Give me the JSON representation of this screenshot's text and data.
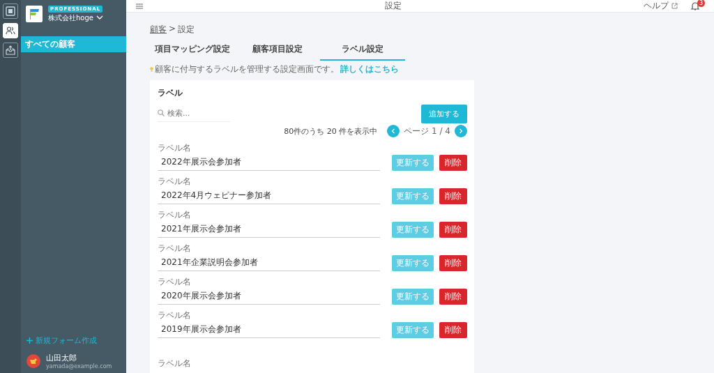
{
  "sidebar": {
    "plan_badge": "PROFESSIONAL",
    "company": "株式会社hoge",
    "rail_icons": [
      {
        "selected": false
      },
      {
        "selected": true
      },
      {
        "selected": false
      }
    ],
    "items": [
      {
        "label": "すべての顧客",
        "selected": true
      }
    ],
    "new_form_link": "新規フォーム作成",
    "user": {
      "name": "山田太郎",
      "email": "yamada@example.com"
    }
  },
  "header": {
    "title": "設定",
    "help": "ヘルプ",
    "notification_count": "3"
  },
  "breadcrumb": {
    "link": "顧客",
    "separator": ">",
    "current": "設定"
  },
  "tabs": [
    {
      "label": "項目マッピング設定",
      "selected": false
    },
    {
      "label": "顧客項目設定",
      "selected": false
    },
    {
      "label": "ラベル設定",
      "selected": true
    }
  ],
  "hint": {
    "text": "顧客に付与するラベルを管理する設定画面です。",
    "link": "詳しくはこちら"
  },
  "card": {
    "title": "ラベル",
    "search": {
      "placeholder": "検索..."
    },
    "add_button": "追加する",
    "count": "80件のうち 20 件を表示中",
    "page": "ページ 1 / 4",
    "rows": [
      {
        "label": "ラベル名",
        "value": "2022年展示会参加者",
        "update": "更新する",
        "delete": "削除"
      },
      {
        "label": "ラベル名",
        "value": "2022年4月ウェビナー参加者",
        "update": "更新する",
        "delete": "削除"
      },
      {
        "label": "ラベル名",
        "value": "2021年展示会参加者",
        "update": "更新する",
        "delete": "削除"
      },
      {
        "label": "ラベル名",
        "value": "2021年企業説明会参加者",
        "update": "更新する",
        "delete": "削除"
      },
      {
        "label": "ラベル名",
        "value": "2020年展示会参加者",
        "update": "更新する",
        "delete": "削除"
      },
      {
        "label": "ラベル名",
        "value": "2019年展示会参加者",
        "update": "更新する",
        "delete": "削除"
      },
      {
        "label": "ラベル名"
      }
    ]
  }
}
